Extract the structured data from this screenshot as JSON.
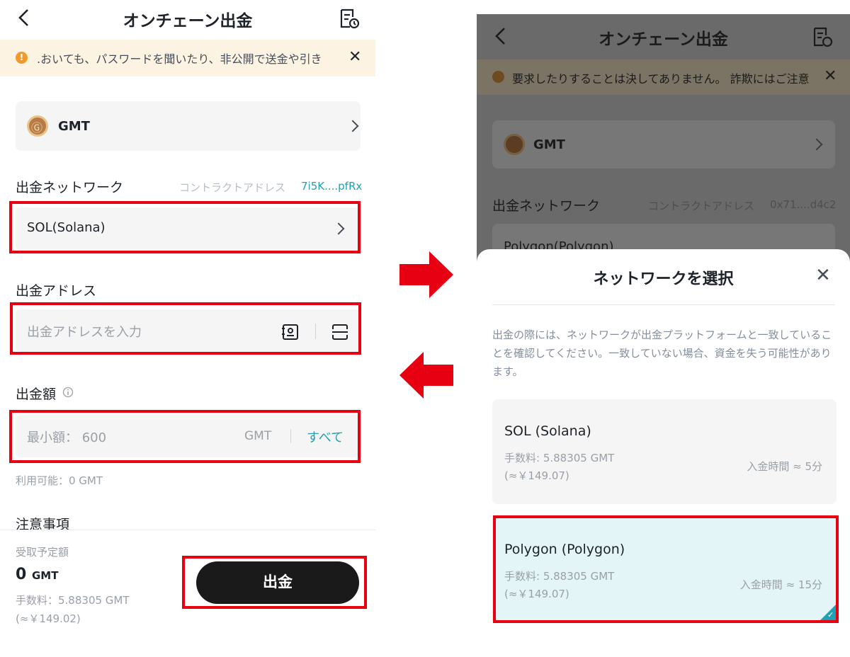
{
  "left": {
    "header": {
      "title": "オンチェーン出金"
    },
    "notice": {
      "text": ".おいても、パスワードを聞いたり、非公開で送金や引き"
    },
    "coin": {
      "name": "GMT"
    },
    "network": {
      "label": "出金ネットワーク",
      "contract_label": "コントラクトアドレス",
      "contract_value": "7i5K....pfRx",
      "selected": "SOL(Solana)"
    },
    "address": {
      "label": "出金アドレス",
      "placeholder": "出金アドレスを入力"
    },
    "amount": {
      "label": "出金額",
      "placeholder": "最小額： 600",
      "unit": "GMT",
      "all": "すべて"
    },
    "available": "利用可能：0 GMT",
    "notes_label": "注意事項",
    "footer": {
      "receive_label": "受取予定額",
      "receive_value": "0",
      "receive_unit": "GMT",
      "fee": "手数料：5.88305 GMT",
      "fee_jpy": "(≈￥149.02)",
      "withdraw_button": "出金"
    }
  },
  "right": {
    "header": {
      "title": "オンチェーン出金"
    },
    "notice": {
      "text": "要求したりすることは決してありません。 詐欺にはご注意"
    },
    "coin": {
      "name": "GMT"
    },
    "network": {
      "label": "出金ネットワーク",
      "contract_label": "コントラクトアドレス",
      "contract_value": "0x71....d4c2",
      "selected": "Polygon(Polygon)"
    },
    "sheet": {
      "title": "ネットワークを選択",
      "description": "出金の際には、ネットワークが出金プラットフォームと一致していることを確認してください。一致していない場合、資金を失う可能性があります。",
      "networks": [
        {
          "name": "SOL (Solana)",
          "fee": "手数料: 5.88305 GMT",
          "fee_jpy": "(≈￥149.07)",
          "eta": "入金時間 ≈ 5分"
        },
        {
          "name": "Polygon (Polygon)",
          "fee": "手数料: 5.88305 GMT",
          "fee_jpy": "(≈￥149.07)",
          "eta": "入金時間 ≈ 15分"
        }
      ]
    }
  },
  "colors": {
    "highlight": "#e60012",
    "accent": "#1ea2b4",
    "selected_bg": "#e3f5f7"
  }
}
